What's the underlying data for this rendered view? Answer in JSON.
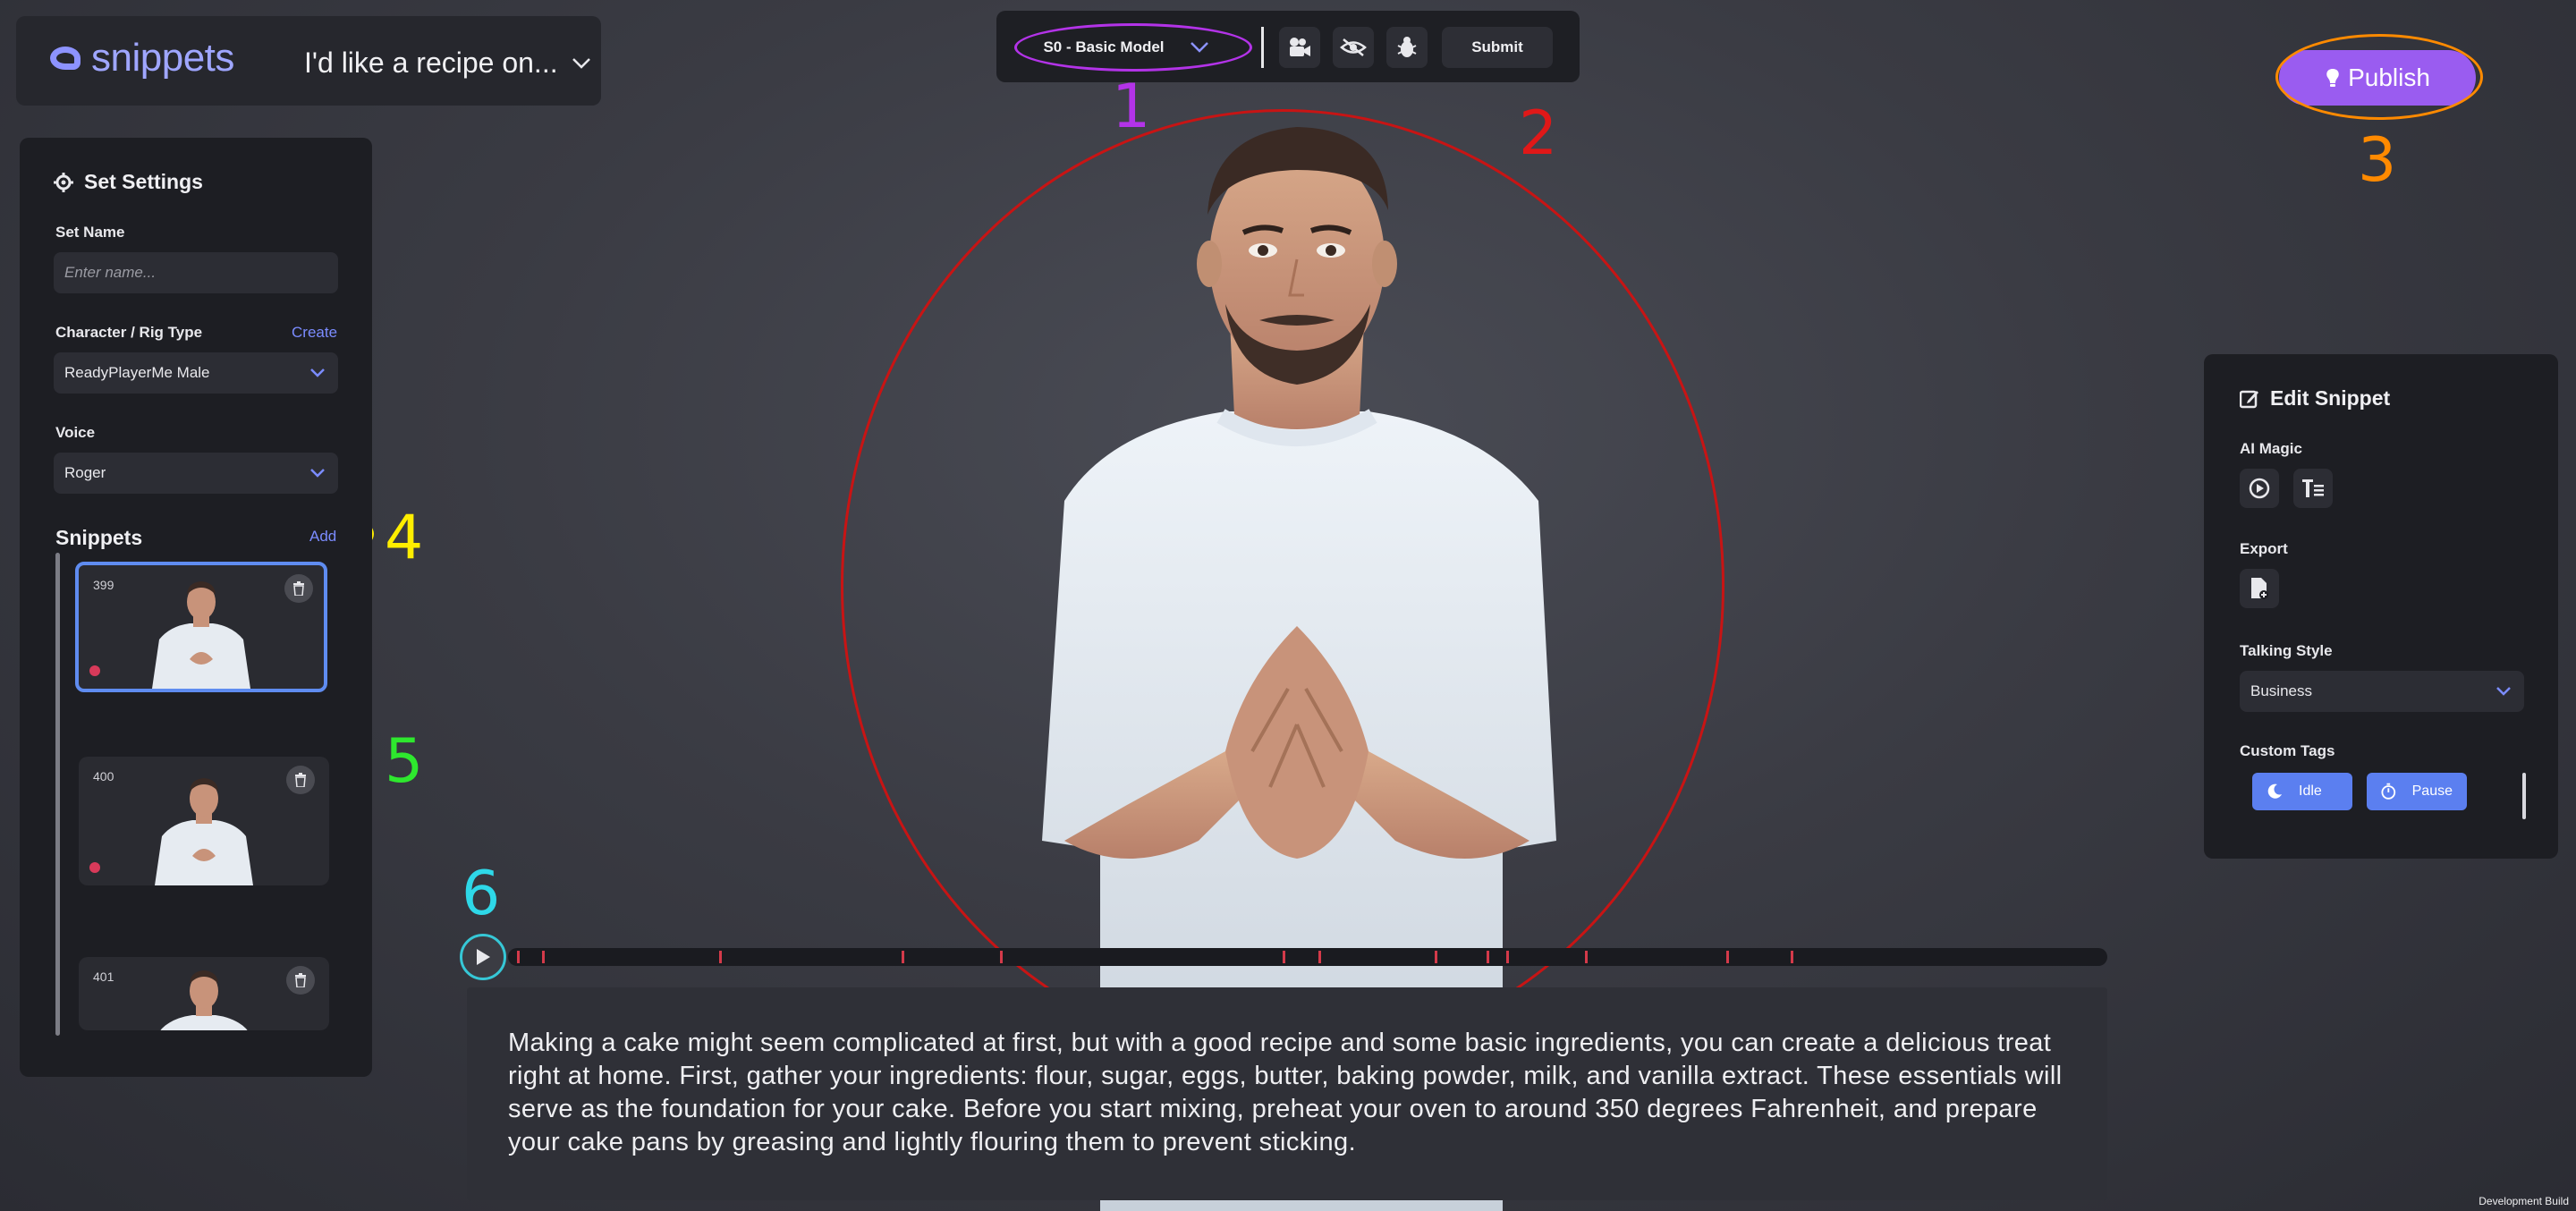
{
  "brand": {
    "logo_text": "snippets",
    "prompt_title": "I'd like a recipe on..."
  },
  "toolbar": {
    "model_label": "S0 - Basic Model",
    "submit_label": "Submit",
    "icons": [
      "camera-icon",
      "eye-off-icon",
      "bug-icon"
    ]
  },
  "publish": {
    "label": "Publish"
  },
  "annotations": {
    "n1": "1",
    "n2": "2",
    "n3": "3",
    "n4": "4",
    "n5": "5",
    "n6": "6"
  },
  "annotation_colors": {
    "n1": "#b333e8",
    "n2": "#e01818",
    "n3": "#ff8a00",
    "n4": "#ffee00",
    "n5": "#2ee82e",
    "n6": "#2ed8e8"
  },
  "settings": {
    "title": "Set Settings",
    "set_name_label": "Set Name",
    "set_name_placeholder": "Enter name...",
    "character_label": "Character / Rig Type",
    "create_link": "Create",
    "character_value": "ReadyPlayerMe Male",
    "voice_label": "Voice",
    "voice_value": "Roger",
    "snippets_label": "Snippets",
    "add_link": "Add",
    "snippets": [
      {
        "id": "399"
      },
      {
        "id": "400"
      },
      {
        "id": "401"
      }
    ]
  },
  "edit": {
    "title": "Edit Snippet",
    "ai_magic_label": "AI Magic",
    "export_label": "Export",
    "talking_style_label": "Talking Style",
    "talking_style_value": "Business",
    "custom_tags_label": "Custom Tags",
    "tags": [
      {
        "label": "Idle"
      },
      {
        "label": "Pause"
      }
    ]
  },
  "transcript": {
    "text": "Making a cake might seem complicated at first, but with a good recipe and some basic ingredients, you can create a delicious treat right at home. First, gather your ingredients: flour, sugar, eggs, butter, baking powder, milk, and vanilla extract. These essentials will serve as the foundation for your cake. Before you start mixing, preheat your oven to around 350 degrees Fahrenheit, and prepare your cake pans by greasing and lightly flouring them to prevent sticking."
  },
  "footer": {
    "dev_build": "Development Build"
  }
}
